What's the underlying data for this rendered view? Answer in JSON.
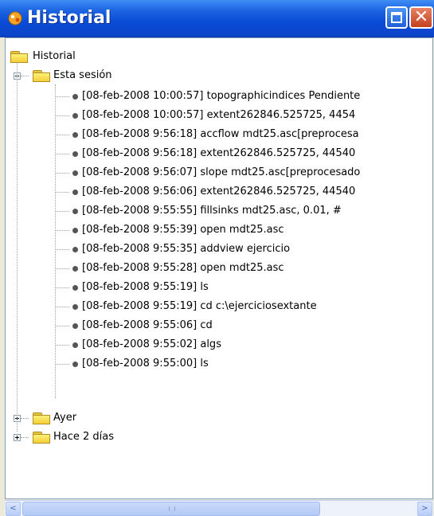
{
  "window": {
    "title": "Historial"
  },
  "tree": {
    "root_label": "Historial",
    "session_label": "Esta sesión",
    "entries": [
      "[08-feb-2008 10:00:57] topographicindices Pendiente",
      "[08-feb-2008 10:00:57] extent262846.525725, 4454",
      "[08-feb-2008 9:56:18] accflow mdt25.asc[preprocesa",
      "[08-feb-2008 9:56:18] extent262846.525725, 44540",
      "[08-feb-2008 9:56:07] slope mdt25.asc[preprocesado",
      "[08-feb-2008 9:56:06] extent262846.525725, 44540",
      "[08-feb-2008 9:55:55] fillsinks mdt25.asc, 0.01, #",
      "[08-feb-2008 9:55:39] open mdt25.asc",
      "[08-feb-2008 9:55:35] addview ejercicio",
      "[08-feb-2008 9:55:28] open mdt25.asc",
      "[08-feb-2008 9:55:19] ls",
      "[08-feb-2008 9:55:19] cd c:\\ejerciciosextante",
      "[08-feb-2008 9:55:06] cd",
      "[08-feb-2008 9:55:02] algs",
      "[08-feb-2008 9:55:00] ls"
    ],
    "ayer_label": "Ayer",
    "hace2_label": "Hace 2 días"
  },
  "scrollbar": {
    "left_arrow": "<",
    "right_arrow": ">"
  }
}
